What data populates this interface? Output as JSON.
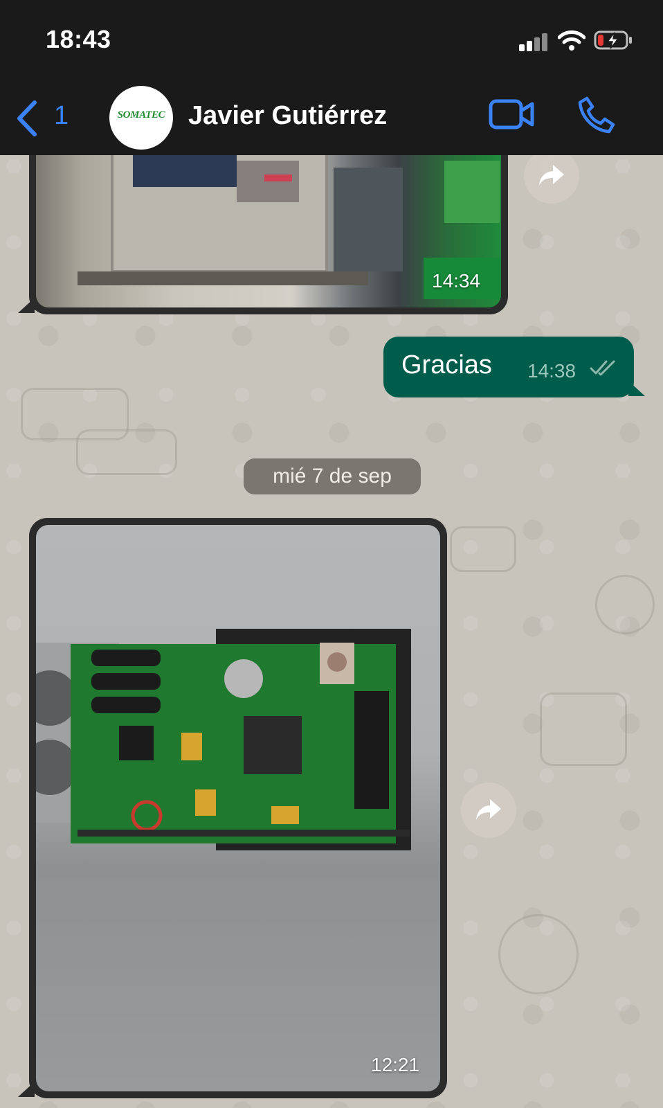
{
  "status_bar": {
    "time": "18:43"
  },
  "header": {
    "back_count": "1",
    "avatar_text": "SOMATEC",
    "contact_name": "Javier Gutiérrez"
  },
  "messages": {
    "image_1": {
      "time": "14:34"
    },
    "outgoing_1": {
      "text": "Gracias",
      "time": "14:38"
    },
    "date_separator": "mié 7 de sep",
    "image_2": {
      "time": "12:21"
    }
  },
  "icons": {
    "back": "chevron-left-icon",
    "video": "video-camera-icon",
    "call": "phone-icon",
    "forward": "forward-arrow-icon",
    "read_receipt": "double-check-icon",
    "signal": "cellular-signal-icon",
    "wifi": "wifi-icon",
    "battery": "battery-charging-icon"
  },
  "colors": {
    "header_bg": "#1a1a1a",
    "accent_blue": "#3b82f6",
    "outgoing_bubble": "#005c4b",
    "chat_background": "#c8c4bc",
    "battery_low": "#e53935"
  }
}
